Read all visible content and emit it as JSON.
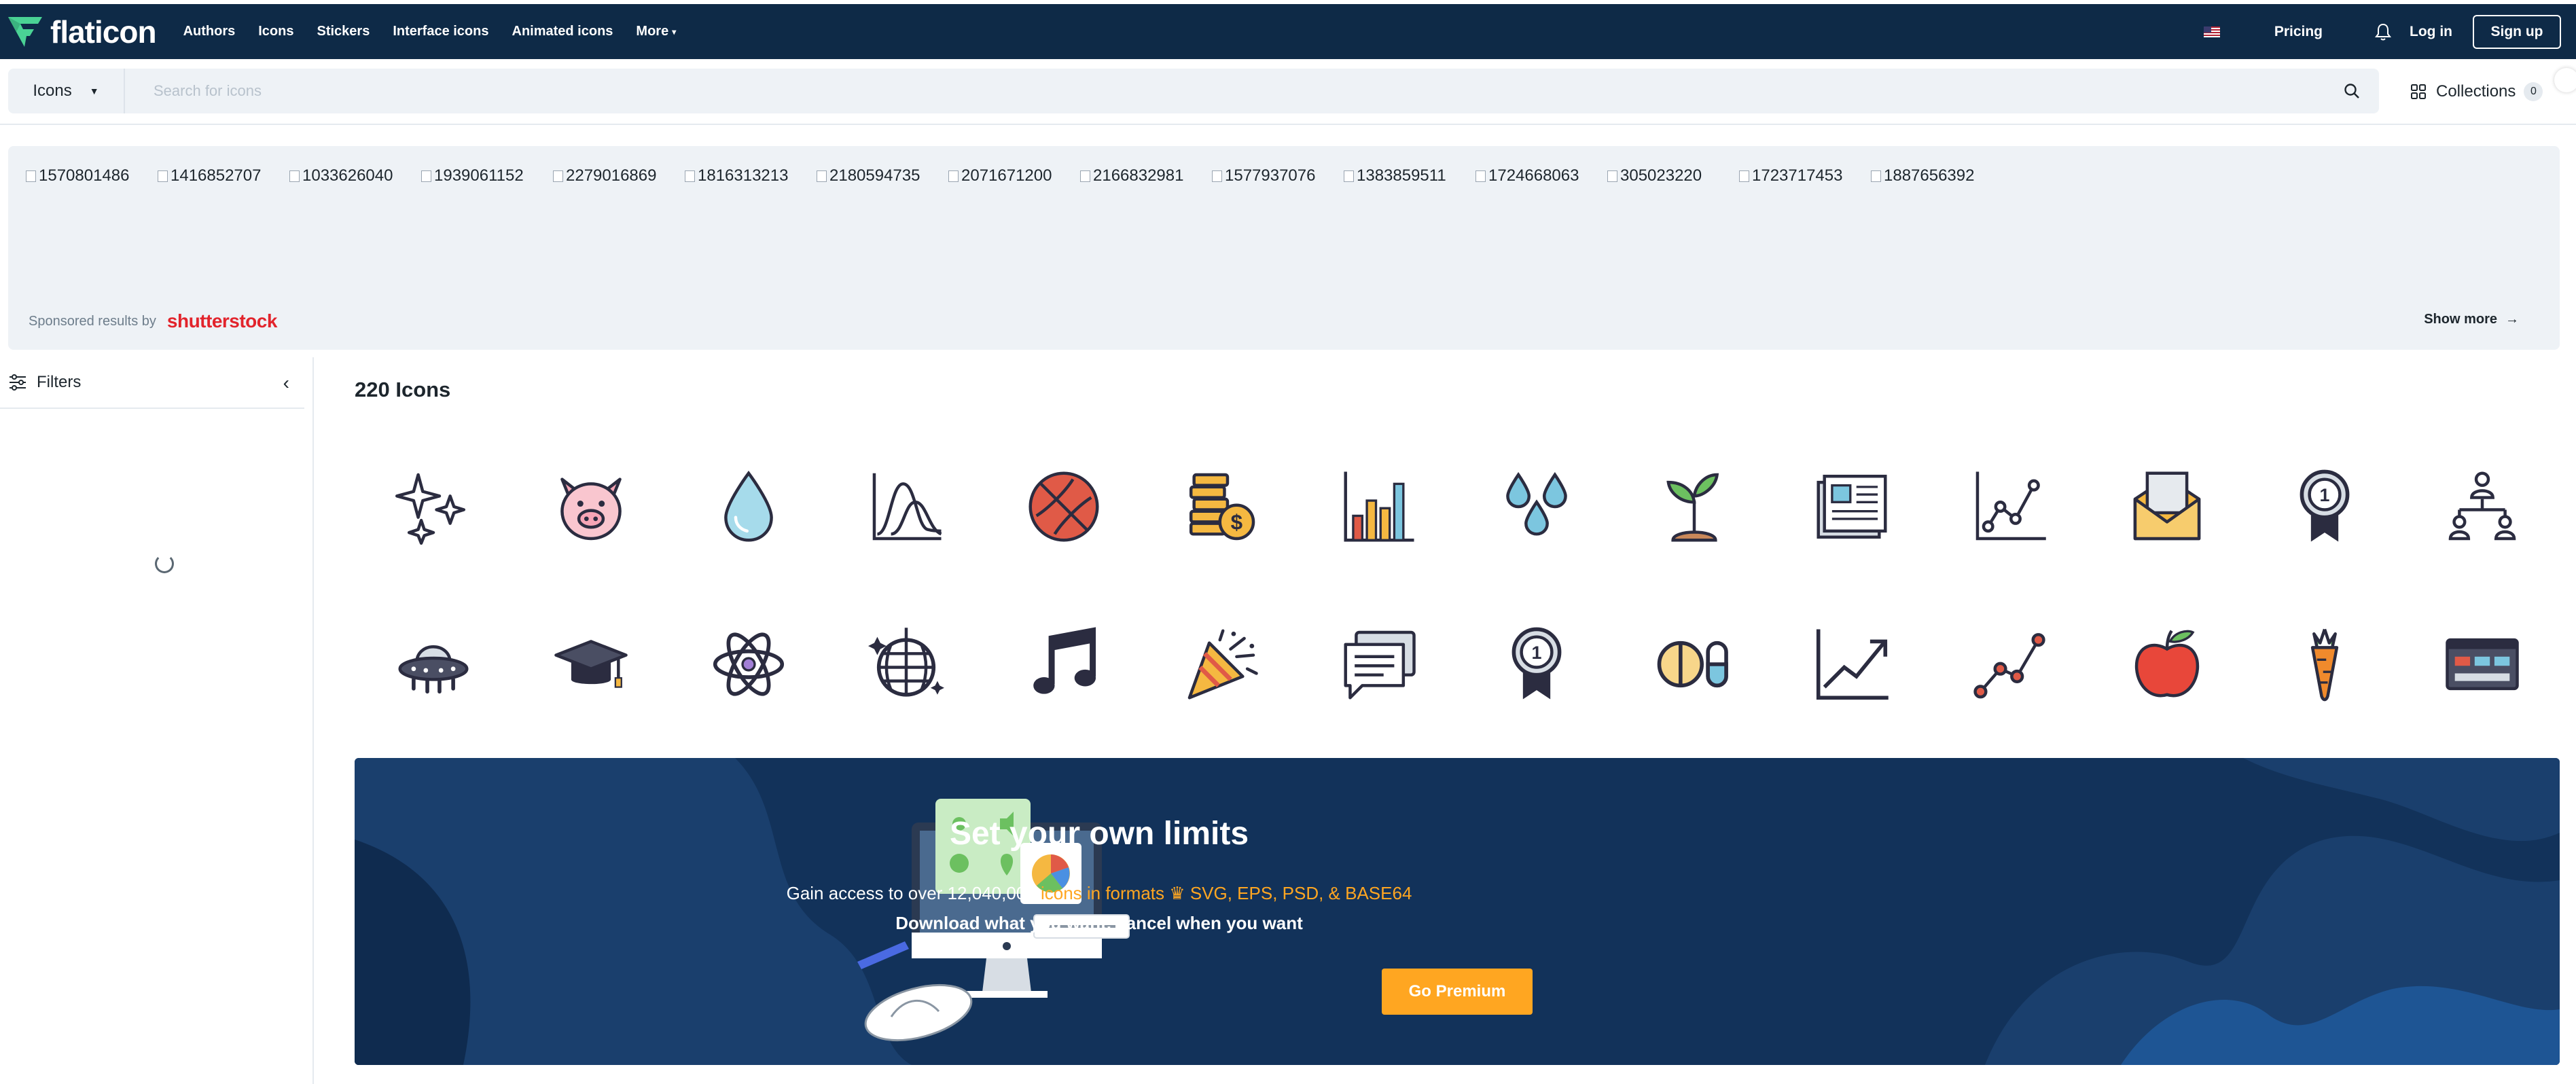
{
  "brand": {
    "name": "flaticon"
  },
  "nav": {
    "items": [
      {
        "label": "Authors"
      },
      {
        "label": "Icons"
      },
      {
        "label": "Stickers"
      },
      {
        "label": "Interface icons"
      },
      {
        "label": "Animated icons"
      },
      {
        "label": "More"
      }
    ],
    "pricing": "Pricing",
    "login": "Log in",
    "signup": "Sign up"
  },
  "search": {
    "type": "Icons",
    "placeholder": "Search for icons",
    "value": ""
  },
  "collections": {
    "label": "Collections",
    "count": "0"
  },
  "sponsored": {
    "images": [
      "1570801486",
      "1416852707",
      "1033626040",
      "1939061152",
      "2279016869",
      "1816313213",
      "2180594735",
      "2071671200",
      "2166832981",
      "1577937076",
      "1383859511",
      "1724668063",
      "305023220",
      "1723717453",
      "1887656392"
    ],
    "by_label": "Sponsored results by",
    "provider": "shutterstock",
    "show_more": "Show more"
  },
  "filters": {
    "label": "Filters"
  },
  "results": {
    "title": "220 Icons",
    "icons": [
      "sparkles-icon",
      "piggy-icon",
      "water-drop-icon",
      "bell-curve-chart-icon",
      "basketball-icon",
      "coins-icon",
      "bar-chart-icon",
      "drops-icon",
      "sprout-icon",
      "newspaper-icon",
      "line-chart-icon",
      "envelope-icon",
      "medal-icon",
      "hierarchy-icon",
      "ufo-icon",
      "graduation-cap-icon",
      "atom-icon",
      "disco-ball-icon",
      "music-note-icon",
      "party-popper-icon",
      "chat-bubbles-icon",
      "award-ribbon-icon",
      "pills-icon",
      "trend-up-icon",
      "data-points-icon",
      "apple-icon",
      "carrot-icon",
      "control-panel-icon"
    ]
  },
  "banner": {
    "title": "Set your own limits",
    "sub_prefix": "Gain access to over 12,040,000 ",
    "sub_highlight_1": "icons in formats",
    "sub_highlight_2": "SVG, EPS, PSD, & BASE64",
    "sub2": "Download what you want, cancel when you want",
    "cta": "Go Premium"
  },
  "colors": {
    "nav_bg": "#0e2a47",
    "banner_bg": "#12325a",
    "accent": "#ffa621",
    "shutterstock": "#e2242c",
    "brand_green": "#4ad295"
  }
}
